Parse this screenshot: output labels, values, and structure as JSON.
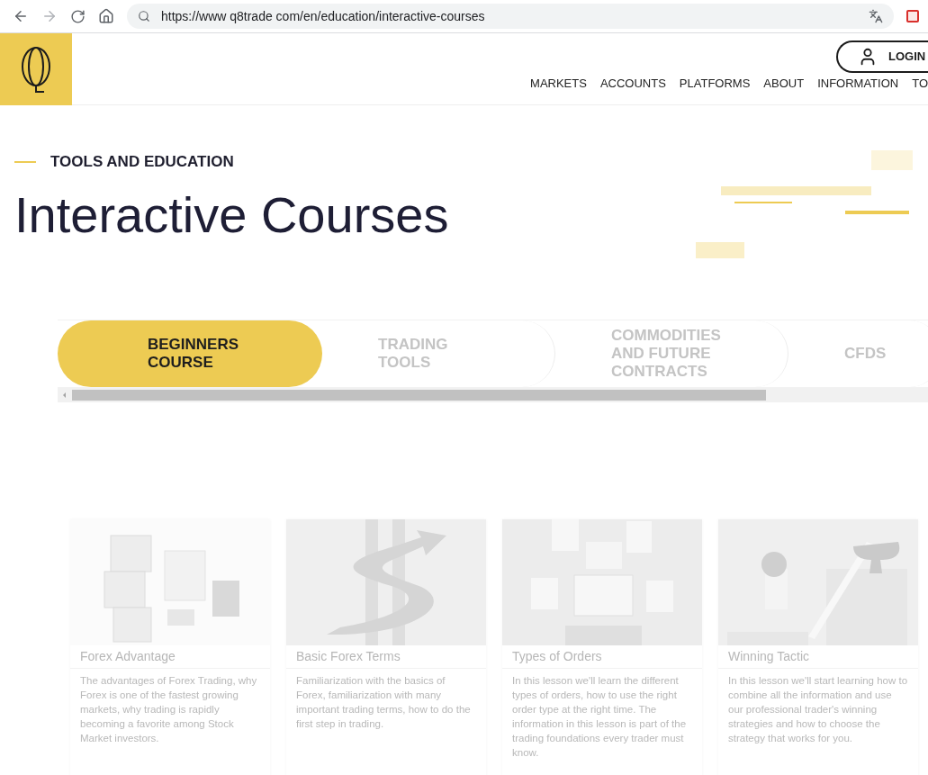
{
  "browser": {
    "url": "https://www q8trade com/en/education/interactive-courses"
  },
  "header": {
    "nav": [
      "MARKETS",
      "ACCOUNTS",
      "PLATFORMS",
      "ABOUT",
      "INFORMATION",
      "TO"
    ],
    "login": "LOGIN"
  },
  "hero": {
    "eyebrow": "TOOLS AND EDUCATION",
    "title": "Interactive Courses"
  },
  "tabs": [
    {
      "label": "BEGINNERS COURSE",
      "selected": true
    },
    {
      "label": "TRADING TOOLS",
      "selected": false
    },
    {
      "label": "COMMODITIES AND FUTURE CONTRACTS",
      "selected": false
    },
    {
      "label": "CFDS",
      "selected": false
    }
  ],
  "cards": [
    {
      "kind": "blocks",
      "title": "Forex Advantage",
      "description": "The advantages of Forex Trading, why Forex is one of the fastest growing markets, why trading is rapidly becoming a favorite among Stock Market investors."
    },
    {
      "kind": "arrow",
      "title": "Basic Forex Terms",
      "description": "Familiarization with the basics of Forex, familiarization with many important trading terms, how to do the first step in trading."
    },
    {
      "kind": "charts",
      "title": "Types of Orders",
      "description": "In this lesson we'll learn the different types of orders, how to use the right order type at the right time. The information in this lesson is part of the trading foundations every trader must know."
    },
    {
      "kind": "ladder",
      "title": "Winning Tactic",
      "description": "In this lesson we'll start learning how to combine all the information and use our professional trader's winning strategies and how to choose the strategy that works for you."
    }
  ]
}
